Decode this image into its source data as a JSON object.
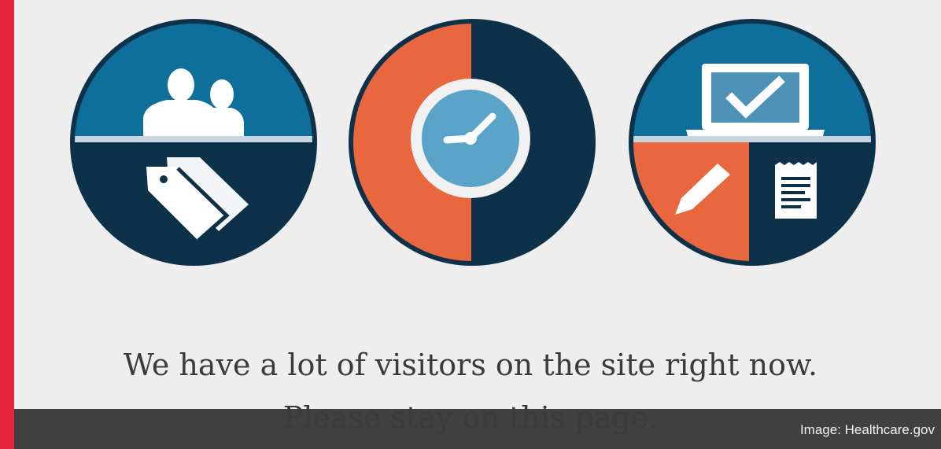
{
  "colors": {
    "accent_bar": "#e8263f",
    "page_background": "#eeeeee",
    "dark_navy": "#0c3148",
    "mid_blue": "#0e6f9b",
    "orange": "#e9673f",
    "light_blue": "#5aa3c8",
    "white": "#ffffff",
    "caption_band": "#2b2b2b"
  },
  "icons": [
    {
      "name": "people-with-tag-icon"
    },
    {
      "name": "clock-icon"
    },
    {
      "name": "laptop-checkmark-pencil-document-icon"
    }
  ],
  "message": {
    "line1": "We have a lot of visitors on the site right now.",
    "line2": "Please stay on this page."
  },
  "caption": "Image: Healthcare.gov"
}
